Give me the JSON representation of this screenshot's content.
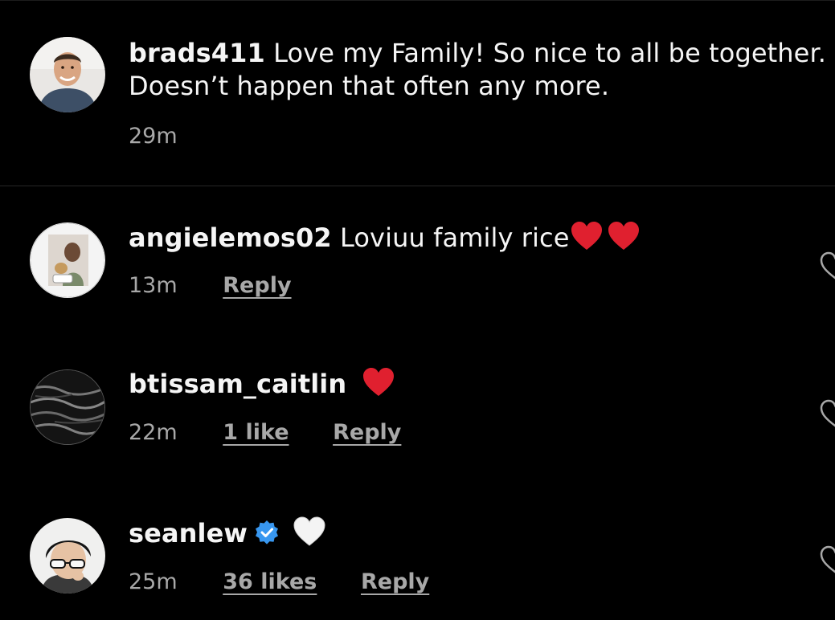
{
  "caption": {
    "username": "brads411",
    "text_line1": "Love my Family! So nice to all be together.",
    "text_line2": "Doesn’t happen that often any more.",
    "time": "29m"
  },
  "comments": [
    {
      "username": "angielemos02",
      "text": "Loviuu family rice",
      "emojis": [
        "red-heart",
        "red-heart"
      ],
      "time": "13m",
      "likes": "",
      "reply_label": "Reply"
    },
    {
      "username": "btissam_caitlin",
      "text": "",
      "emojis": [
        "red-heart"
      ],
      "time": "22m",
      "likes": "1 like",
      "reply_label": "Reply"
    },
    {
      "username": "seanlew",
      "verified": true,
      "text": "",
      "emojis": [
        "white-heart"
      ],
      "time": "25m",
      "likes": "36 likes",
      "reply_label": "Reply"
    }
  ],
  "colors": {
    "background": "#000000",
    "text": "#f5f5f5",
    "meta": "#a8a8a8",
    "verified": "#3897f0",
    "red_heart": "#e0202f"
  }
}
